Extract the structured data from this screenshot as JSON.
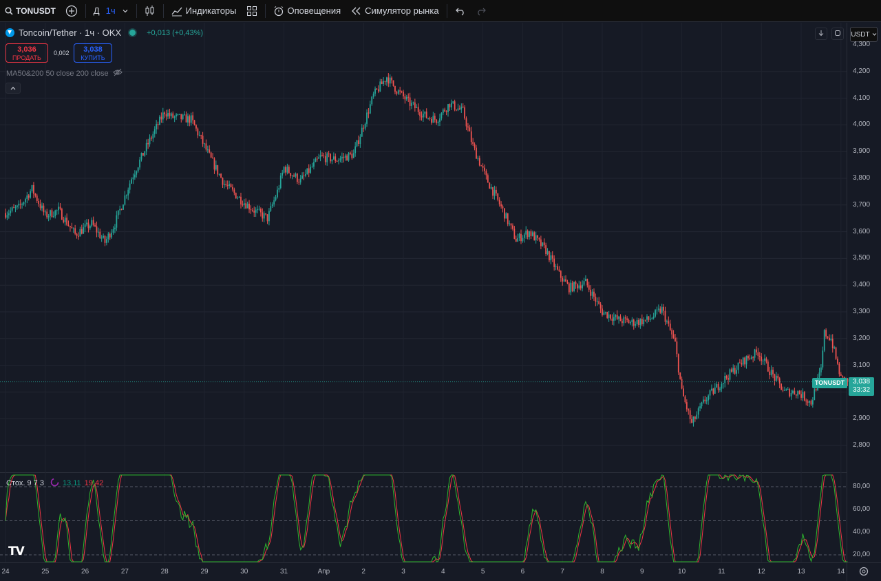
{
  "toolbar": {
    "symbol": "TONUSDT",
    "interval_day": "Д",
    "interval_selected": "1ч",
    "indicators_label": "Индикаторы",
    "alerts_label": "Оповещения",
    "replay_label": "Симулятор рынка"
  },
  "legend": {
    "title": "Toncoin/Tether · 1ч · OKX",
    "change": "+0,013 (+0,43%)"
  },
  "trade": {
    "sell_price": "3,036",
    "sell_label": "ПРОДАТЬ",
    "spread": "0,002",
    "buy_price": "3,038",
    "buy_label": "КУПИТЬ"
  },
  "ma_indicator": "MA50&200 50 close 200 close",
  "currency_unit": "USDT",
  "price_axis": [
    "4,300",
    "4,200",
    "4,100",
    "4,000",
    "3,900",
    "3,800",
    "3,700",
    "3,600",
    "3,500",
    "3,400",
    "3,300",
    "3,200",
    "3,100",
    "3,000",
    "2,900",
    "2,800"
  ],
  "last_price": {
    "symbol": "TONUSDT",
    "price": "3,038",
    "countdown": "33:32"
  },
  "stoch": {
    "label": "Стох. 9 7 3",
    "k": "13,11",
    "d": "19,42",
    "k_color": "#089981",
    "d_color": "#f23645"
  },
  "stoch_axis": [
    "80,00",
    "60,00",
    "40,00",
    "20,00"
  ],
  "time_axis": [
    "24",
    "25",
    "26",
    "27",
    "28",
    "29",
    "30",
    "31",
    "Апр",
    "2",
    "3",
    "4",
    "5",
    "6",
    "7",
    "8",
    "9",
    "10",
    "11",
    "12",
    "13",
    "14"
  ],
  "colors": {
    "up": "#26a69a",
    "down": "#ef5350",
    "background": "#161a25",
    "accent": "#2962ff"
  },
  "chart_data": {
    "type": "candlestick",
    "interval": "1h",
    "x_unit": "hours from 24 Mar 00:00",
    "ylim": [
      2.75,
      4.3
    ],
    "anchors": [
      [
        0,
        3.67
      ],
      [
        8,
        3.69
      ],
      [
        16,
        3.76
      ],
      [
        24,
        3.66
      ],
      [
        32,
        3.68
      ],
      [
        42,
        3.59
      ],
      [
        52,
        3.63
      ],
      [
        60,
        3.56
      ],
      [
        66,
        3.63
      ],
      [
        76,
        3.8
      ],
      [
        86,
        3.93
      ],
      [
        96,
        4.05
      ],
      [
        100,
        4.03
      ],
      [
        112,
        4.02
      ],
      [
        124,
        3.87
      ],
      [
        132,
        3.78
      ],
      [
        142,
        3.72
      ],
      [
        150,
        3.68
      ],
      [
        158,
        3.65
      ],
      [
        164,
        3.75
      ],
      [
        168,
        3.84
      ],
      [
        178,
        3.79
      ],
      [
        190,
        3.88
      ],
      [
        200,
        3.87
      ],
      [
        210,
        3.89
      ],
      [
        222,
        4.11
      ],
      [
        230,
        4.18
      ],
      [
        236,
        4.13
      ],
      [
        244,
        4.08
      ],
      [
        254,
        4.03
      ],
      [
        260,
        4.02
      ],
      [
        268,
        4.08
      ],
      [
        276,
        4.05
      ],
      [
        282,
        3.92
      ],
      [
        290,
        3.8
      ],
      [
        300,
        3.68
      ],
      [
        308,
        3.57
      ],
      [
        316,
        3.6
      ],
      [
        326,
        3.53
      ],
      [
        334,
        3.44
      ],
      [
        340,
        3.39
      ],
      [
        350,
        3.41
      ],
      [
        360,
        3.3
      ],
      [
        370,
        3.27
      ],
      [
        378,
        3.26
      ],
      [
        388,
        3.27
      ],
      [
        396,
        3.31
      ],
      [
        404,
        3.18
      ],
      [
        408,
        3.0
      ],
      [
        414,
        2.88
      ],
      [
        422,
        2.97
      ],
      [
        434,
        3.05
      ],
      [
        446,
        3.12
      ],
      [
        454,
        3.15
      ],
      [
        462,
        3.07
      ],
      [
        470,
        3.0
      ],
      [
        478,
        3.0
      ],
      [
        486,
        2.96
      ],
      [
        492,
        3.08
      ],
      [
        494,
        3.22
      ],
      [
        498,
        3.2
      ],
      [
        504,
        3.05
      ],
      [
        508,
        3.04
      ]
    ]
  }
}
